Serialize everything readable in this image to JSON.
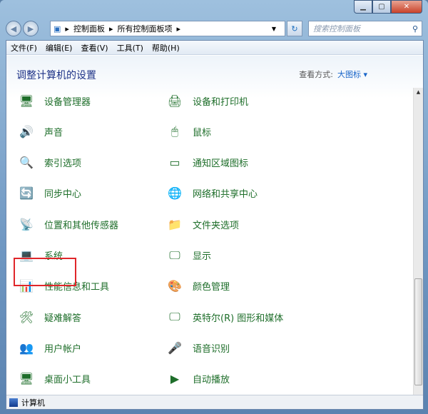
{
  "address": {
    "crumbs": [
      "控制面板",
      "所有控制面板项"
    ]
  },
  "search": {
    "placeholder": "搜索控制面板"
  },
  "menu": [
    "文件(F)",
    "编辑(E)",
    "查看(V)",
    "工具(T)",
    "帮助(H)"
  ],
  "header": {
    "title": "调整计算机的设置",
    "view_label": "查看方式:",
    "view_value": "大图标 ▾"
  },
  "items_left": [
    "设备管理器",
    "声音",
    "索引选项",
    "同步中心",
    "位置和其他传感器",
    "系统",
    "性能信息和工具",
    "疑难解答",
    "用户帐户",
    "桌面小工具"
  ],
  "items_right": [
    "设备和打印机",
    "鼠标",
    "通知区域图标",
    "网络和共享中心",
    "文件夹选项",
    "显示",
    "颜色管理",
    "英特尔(R) 图形和媒体",
    "语音识别",
    "自动播放"
  ],
  "status": {
    "text": "计算机"
  },
  "selected_item": "系统",
  "accent": "#e0262a"
}
